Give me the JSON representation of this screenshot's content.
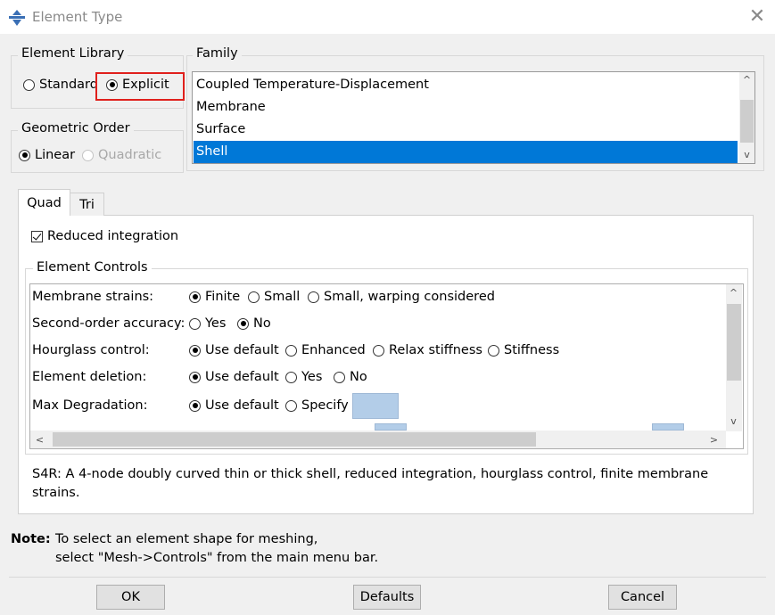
{
  "window": {
    "title": "Element Type",
    "close_glyph": "✕"
  },
  "element_library": {
    "legend": "Element Library",
    "options": [
      {
        "label": "Standard",
        "selected": false
      },
      {
        "label": "Explicit",
        "selected": true
      }
    ],
    "highlight_color": "#e0201c"
  },
  "geometric_order": {
    "legend": "Geometric Order",
    "options": [
      {
        "label": "Linear",
        "selected": true,
        "enabled": true
      },
      {
        "label": "Quadratic",
        "selected": false,
        "enabled": false
      }
    ]
  },
  "family": {
    "legend": "Family",
    "items": [
      "Coupled Temperature-Displacement",
      "Membrane",
      "Surface",
      "Shell"
    ],
    "selected": "Shell",
    "selection_color": "#0078d7"
  },
  "tabs": [
    {
      "label": "Quad",
      "active": true
    },
    {
      "label": "Tri",
      "active": false
    }
  ],
  "reduced_integration": {
    "label": "Reduced integration",
    "checked": true
  },
  "element_controls": {
    "legend": "Element Controls",
    "rows": [
      {
        "label": "Membrane strains:",
        "options": [
          "Finite",
          "Small",
          "Small, warping considered"
        ],
        "selected": "Finite"
      },
      {
        "label": "Second-order accuracy:",
        "options": [
          "Yes",
          "No"
        ],
        "selected": "No"
      },
      {
        "label": "Hourglass control:",
        "options": [
          "Use default",
          "Enhanced",
          "Relax stiffness",
          "Stiffness"
        ],
        "selected": "Use default"
      },
      {
        "label": "Element deletion:",
        "options": [
          "Use default",
          "Yes",
          "No"
        ],
        "selected": "Use default"
      },
      {
        "label": "Max Degradation:",
        "options": [
          "Use default",
          "Specify"
        ],
        "selected": "Use default"
      }
    ]
  },
  "description": {
    "line1": "S4R:  A 4-node doubly curved thin or thick shell, reduced integration, hourglass control, finite membrane",
    "line2": "strains."
  },
  "note": {
    "label": "Note:",
    "line1": "To select an element shape for meshing,",
    "line2": "select \"Mesh->Controls\" from the main menu bar."
  },
  "buttons": {
    "ok": "OK",
    "defaults": "Defaults",
    "cancel": "Cancel"
  },
  "scroll_glyphs": {
    "up": "^",
    "down": "v",
    "left": "<",
    "right": ">"
  }
}
